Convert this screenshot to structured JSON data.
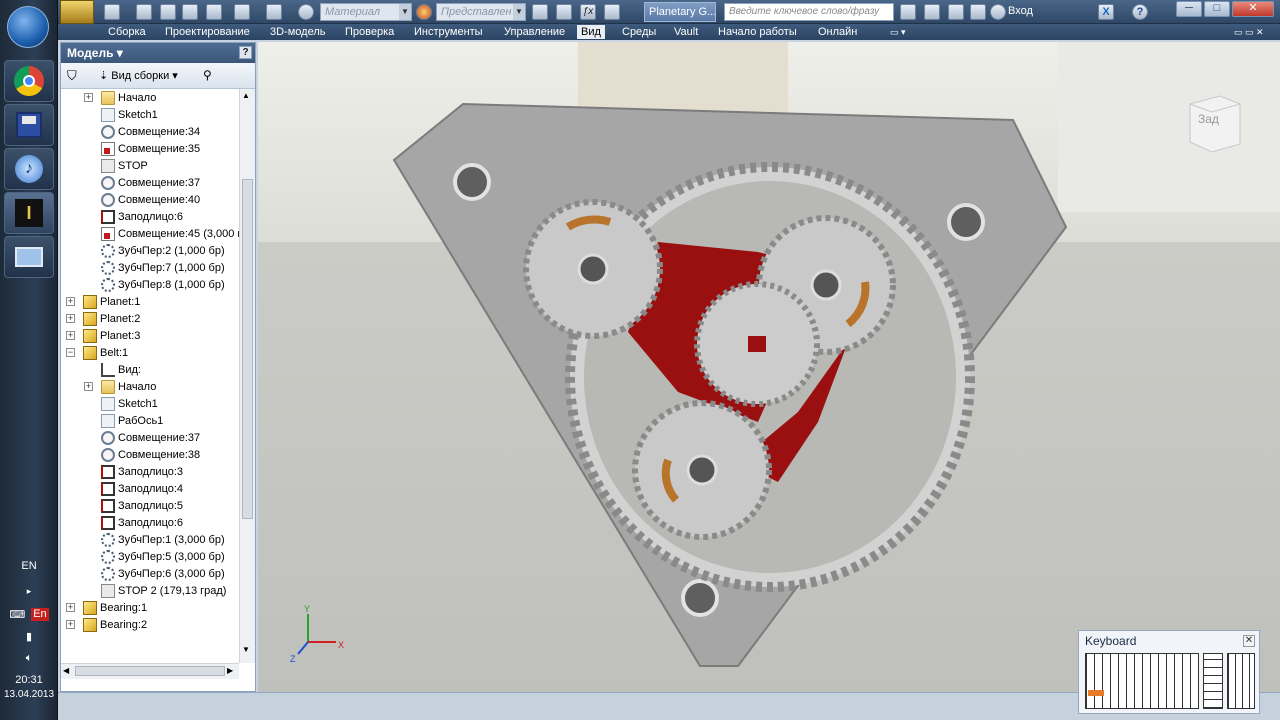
{
  "taskbar": {
    "language": "EN",
    "input_lang": "En",
    "time": "20:31",
    "date": "13.04.2013",
    "apps": [
      "chrome-icon",
      "save-icon",
      "itunes-icon",
      "inventor-icon",
      "remote-icon"
    ]
  },
  "qat": {
    "material_placeholder": "Материал",
    "representation_placeholder": "Представлен",
    "document_tab": "Planetary G...",
    "search_placeholder": "Введите ключевое слово/фразу",
    "signin": "Вход"
  },
  "menu": {
    "items": [
      "Сборка",
      "Проектирование",
      "3D-модель",
      "Проверка",
      "Инструменты",
      "Управление",
      "Вид",
      "Среды",
      "Vault",
      "Начало работы",
      "Онлайн"
    ],
    "active": "Вид"
  },
  "browser": {
    "title": "Модель ▾",
    "help": "?",
    "view_label": "Вид сборки",
    "tree": [
      {
        "label": "Начало",
        "icon": "folder-icon",
        "indent": 1,
        "expand": "+"
      },
      {
        "label": "Sketch1",
        "icon": "sketch-icon",
        "indent": 1
      },
      {
        "label": "Совмещение:34",
        "icon": "constraint-icon",
        "indent": 1
      },
      {
        "label": "Совмещение:35",
        "icon": "mate-red-icon",
        "indent": 1
      },
      {
        "label": "STOP",
        "icon": "stop-icon",
        "indent": 1
      },
      {
        "label": "Совмещение:37",
        "icon": "constraint-icon",
        "indent": 1
      },
      {
        "label": "Совмещение:40",
        "icon": "constraint-icon",
        "indent": 1
      },
      {
        "label": "Заподлицо:6",
        "icon": "flush-icon",
        "indent": 1
      },
      {
        "label": "Совмещение:45 (3,000 м",
        "icon": "mate-red-icon",
        "indent": 1
      },
      {
        "label": "ЗубчПер:2 (1,000 бр)",
        "icon": "gear-constraint-icon",
        "indent": 1
      },
      {
        "label": "ЗубчПер:7 (1,000 бр)",
        "icon": "gear-constraint-icon",
        "indent": 1
      },
      {
        "label": "ЗубчПер:8 (1,000 бр)",
        "icon": "gear-constraint-icon",
        "indent": 1
      },
      {
        "label": "Planet:1",
        "icon": "part-icon",
        "indent": 0,
        "expand": "+"
      },
      {
        "label": "Planet:2",
        "icon": "part-icon",
        "indent": 0,
        "expand": "+"
      },
      {
        "label": "Planet:3",
        "icon": "part-icon",
        "indent": 0,
        "expand": "+"
      },
      {
        "label": "Belt:1",
        "icon": "part-icon",
        "indent": 0,
        "expand": "−"
      },
      {
        "label": "Вид:",
        "icon": "view-icon",
        "indent": 1
      },
      {
        "label": "Начало",
        "icon": "folder-icon",
        "indent": 1,
        "expand": "+"
      },
      {
        "label": "Sketch1",
        "icon": "sketch-icon",
        "indent": 1
      },
      {
        "label": "РабОсь1",
        "icon": "axis-icon",
        "indent": 1
      },
      {
        "label": "Совмещение:37",
        "icon": "constraint-icon",
        "indent": 1
      },
      {
        "label": "Совмещение:38",
        "icon": "constraint-icon",
        "indent": 1
      },
      {
        "label": "Заподлицо:3",
        "icon": "flush-icon",
        "indent": 1
      },
      {
        "label": "Заподлицо:4",
        "icon": "flush-icon",
        "indent": 1
      },
      {
        "label": "Заподлицо:5",
        "icon": "flush-icon",
        "indent": 1
      },
      {
        "label": "Заподлицо:6",
        "icon": "flush-icon",
        "indent": 1
      },
      {
        "label": "ЗубчПер:1 (3,000 бр)",
        "icon": "gear-constraint-icon",
        "indent": 1
      },
      {
        "label": "ЗубчПер:5 (3,000 бр)",
        "icon": "gear-constraint-icon",
        "indent": 1
      },
      {
        "label": "ЗубчПер:6 (3,000 бр)",
        "icon": "gear-constraint-icon",
        "indent": 1
      },
      {
        "label": "STOP 2 (179,13 град)",
        "icon": "stop-icon",
        "indent": 1
      },
      {
        "label": "Bearing:1",
        "icon": "bearing-icon",
        "indent": 0,
        "expand": "+"
      },
      {
        "label": "Bearing:2",
        "icon": "bearing-icon",
        "indent": 0,
        "expand": "+"
      }
    ]
  },
  "viewport": {
    "viewcube_label": "Зад",
    "axis_labels": [
      "Y",
      "X",
      "Z"
    ]
  },
  "keyboard_panel": {
    "title": "Keyboard",
    "close": "✕"
  },
  "colors": {
    "ring_gear": "#cfcfcf",
    "carrier": "#9a1010",
    "plate": "#a9a9a9",
    "accent": "#e89a2c"
  }
}
